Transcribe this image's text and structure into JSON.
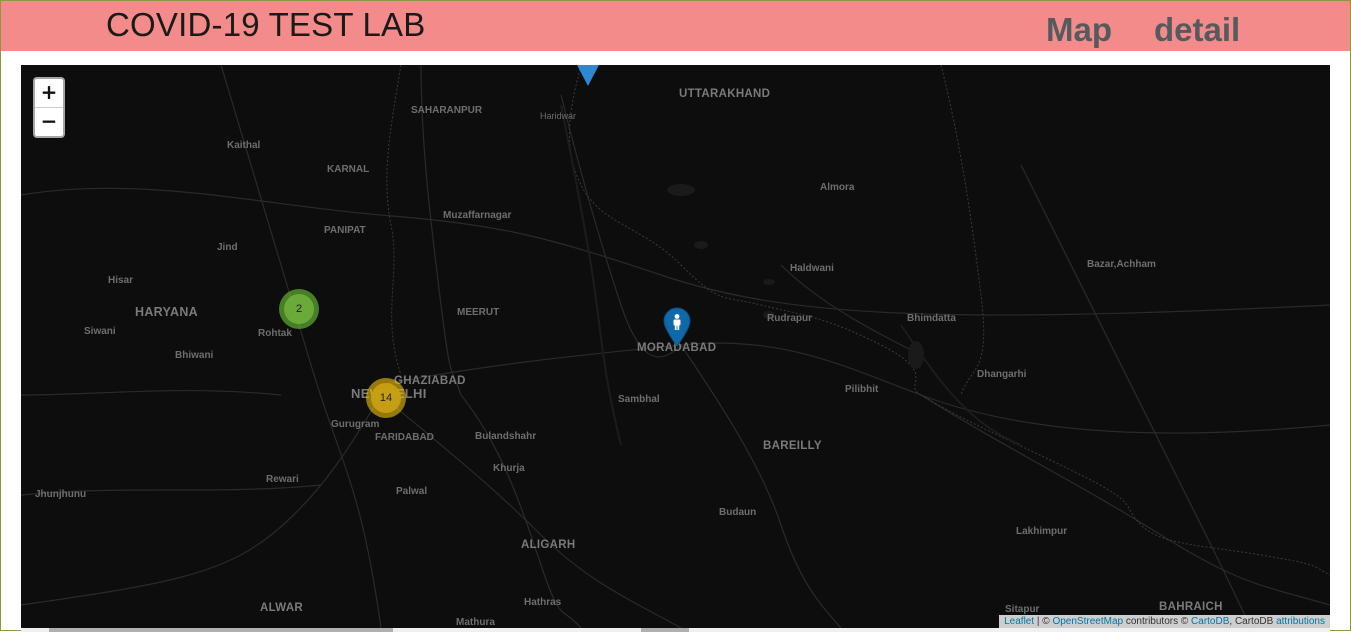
{
  "header": {
    "brand": "COVID-19 TEST LAB",
    "nav": {
      "map": "Map",
      "detail": "detail"
    },
    "background": "#f28b89"
  },
  "map": {
    "zoom_in": "+",
    "zoom_out": "−",
    "places": [
      {
        "id": "uttarakhand",
        "name": "UTTARAKHAND"
      },
      {
        "id": "saharanpur",
        "name": "SAHARANPUR"
      },
      {
        "id": "haridwar",
        "name": "Haridwar"
      },
      {
        "id": "kaithal",
        "name": "Kaithal"
      },
      {
        "id": "karnal",
        "name": "KARNAL"
      },
      {
        "id": "almora",
        "name": "Almora"
      },
      {
        "id": "muzaffarnagar",
        "name": "Muzaffarnagar"
      },
      {
        "id": "panipat",
        "name": "PANIPAT"
      },
      {
        "id": "jind",
        "name": "Jind"
      },
      {
        "id": "haldwani",
        "name": "Haldwani"
      },
      {
        "id": "bazar-achham",
        "name": "Bazar,Achham"
      },
      {
        "id": "hisar",
        "name": "Hisar"
      },
      {
        "id": "haryana",
        "name": "HARYANA"
      },
      {
        "id": "meerut",
        "name": "MEERUT"
      },
      {
        "id": "rudrapur",
        "name": "Rudrapur"
      },
      {
        "id": "bhimdatta",
        "name": "Bhimdatta"
      },
      {
        "id": "siwani",
        "name": "Siwani"
      },
      {
        "id": "rohtak",
        "name": "Rohtak"
      },
      {
        "id": "moradabad",
        "name": "MORADABAD"
      },
      {
        "id": "bhiwani",
        "name": "Bhiwani"
      },
      {
        "id": "dhangarhi",
        "name": "Dhangarhi"
      },
      {
        "id": "ghaziabad",
        "name": "GHAZIABAD"
      },
      {
        "id": "new-delhi",
        "name": "NEW DELHI"
      },
      {
        "id": "pilibhit",
        "name": "Pilibhit"
      },
      {
        "id": "sambhal",
        "name": "Sambhal"
      },
      {
        "id": "gurugram",
        "name": "Gurugram"
      },
      {
        "id": "faridabad",
        "name": "FARIDABAD"
      },
      {
        "id": "bulandshahr",
        "name": "Bulandshahr"
      },
      {
        "id": "bareilly",
        "name": "BAREILLY"
      },
      {
        "id": "khurja",
        "name": "Khurja"
      },
      {
        "id": "rewari",
        "name": "Rewari"
      },
      {
        "id": "jhunjhunu",
        "name": "Jhunjhunu"
      },
      {
        "id": "palwal",
        "name": "Palwal"
      },
      {
        "id": "budaun",
        "name": "Budaun"
      },
      {
        "id": "lakhimpur",
        "name": "Lakhimpur"
      },
      {
        "id": "aligarh",
        "name": "ALIGARH"
      },
      {
        "id": "alwar",
        "name": "ALWAR"
      },
      {
        "id": "hathras",
        "name": "Hathras"
      },
      {
        "id": "sitapur",
        "name": "Sitapur"
      },
      {
        "id": "bahraich",
        "name": "BAHRAICH"
      },
      {
        "id": "mathura",
        "name": "Mathura"
      }
    ],
    "clusters": [
      {
        "id": "rohtak-cluster",
        "count": "2",
        "color": "#6ecc39"
      },
      {
        "id": "delhi-cluster",
        "count": "14",
        "color": "#f0c20c"
      }
    ],
    "attribution": {
      "leaflet": "Leaflet",
      "sep1": " | © ",
      "osm": "OpenStreetMap",
      "contrib": " contributors © ",
      "carto": "CartoDB",
      "carto2": ", CartoDB ",
      "attributions": "attributions"
    }
  }
}
